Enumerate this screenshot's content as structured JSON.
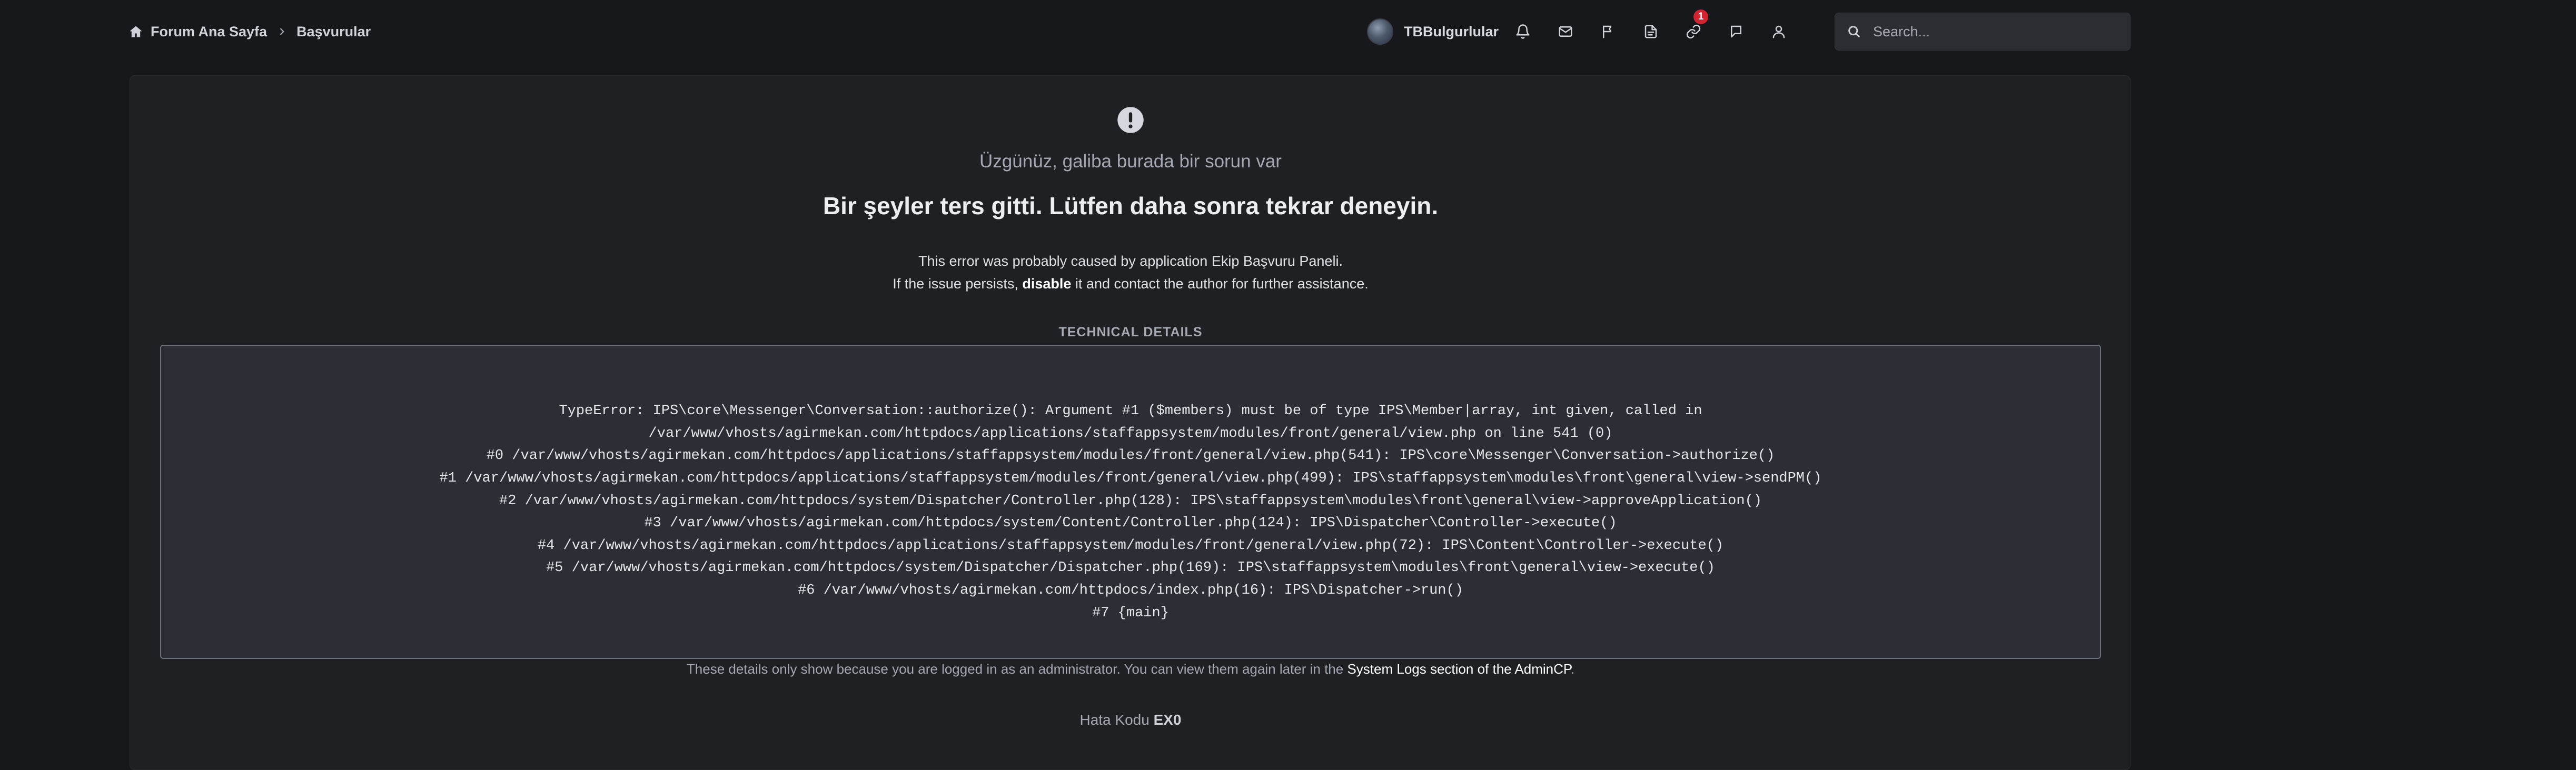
{
  "breadcrumb": {
    "home_label": "Forum Ana Sayfa",
    "current_label": "Başvurular"
  },
  "user": {
    "name": "TBBulgurlular"
  },
  "notifications": {
    "link_badge_count": "1"
  },
  "search": {
    "placeholder": "Search..."
  },
  "error": {
    "subtitle": "Üzgünüz, galiba burada bir sorun var",
    "title": "Bir şeyler ters gitti. Lütfen daha sonra tekrar deneyin.",
    "cause_line": "This error was probably caused by application Ekip Başvuru Paneli.",
    "persist_prefix": "If the issue persists, ",
    "disable_link": "disable",
    "persist_suffix": " it and contact the author for further assistance.",
    "technical_label": "TECHNICAL DETAILS",
    "technical_lines": [
      "TypeError: IPS\\core\\Messenger\\Conversation::authorize(): Argument #1 ($members) must be of type IPS\\Member|array, int given, called in",
      "/var/www/vhosts/agirmekan.com/httpdocs/applications/staffappsystem/modules/front/general/view.php on line 541 (0)",
      "#0 /var/www/vhosts/agirmekan.com/httpdocs/applications/staffappsystem/modules/front/general/view.php(541): IPS\\core\\Messenger\\Conversation->authorize()",
      "#1 /var/www/vhosts/agirmekan.com/httpdocs/applications/staffappsystem/modules/front/general/view.php(499): IPS\\staffappsystem\\modules\\front\\general\\view->sendPM()",
      "#2 /var/www/vhosts/agirmekan.com/httpdocs/system/Dispatcher/Controller.php(128): IPS\\staffappsystem\\modules\\front\\general\\view->approveApplication()",
      "#3 /var/www/vhosts/agirmekan.com/httpdocs/system/Content/Controller.php(124): IPS\\Dispatcher\\Controller->execute()",
      "#4 /var/www/vhosts/agirmekan.com/httpdocs/applications/staffappsystem/modules/front/general/view.php(72): IPS\\Content\\Controller->execute()",
      "#5 /var/www/vhosts/agirmekan.com/httpdocs/system/Dispatcher/Dispatcher.php(169): IPS\\staffappsystem\\modules\\front\\general\\view->execute()",
      "#6 /var/www/vhosts/agirmekan.com/httpdocs/index.php(16): IPS\\Dispatcher->run()",
      "#7 {main}"
    ],
    "admin_note_prefix": "These details only show because you are logged in as an administrator. You can view them again later in the ",
    "admin_note_link": "System Logs section of the AdminCP",
    "admin_note_suffix": ".",
    "code_label": "Hata Kodu ",
    "code_value": "EX0"
  },
  "icons": {
    "home": "home-icon",
    "chevron": "chevron-right-icon",
    "bell": "bell-icon",
    "mail": "envelope-icon",
    "flag": "flag-icon",
    "document": "document-icon",
    "link": "link-icon",
    "chat": "chat-bubble-icon",
    "user": "user-icon",
    "search": "search-icon",
    "alert": "exclamation-circle-icon"
  },
  "colors": {
    "background": "#17181c",
    "card": "#1f2024",
    "badge": "#d1242f",
    "code_box": "#2c2e35"
  }
}
